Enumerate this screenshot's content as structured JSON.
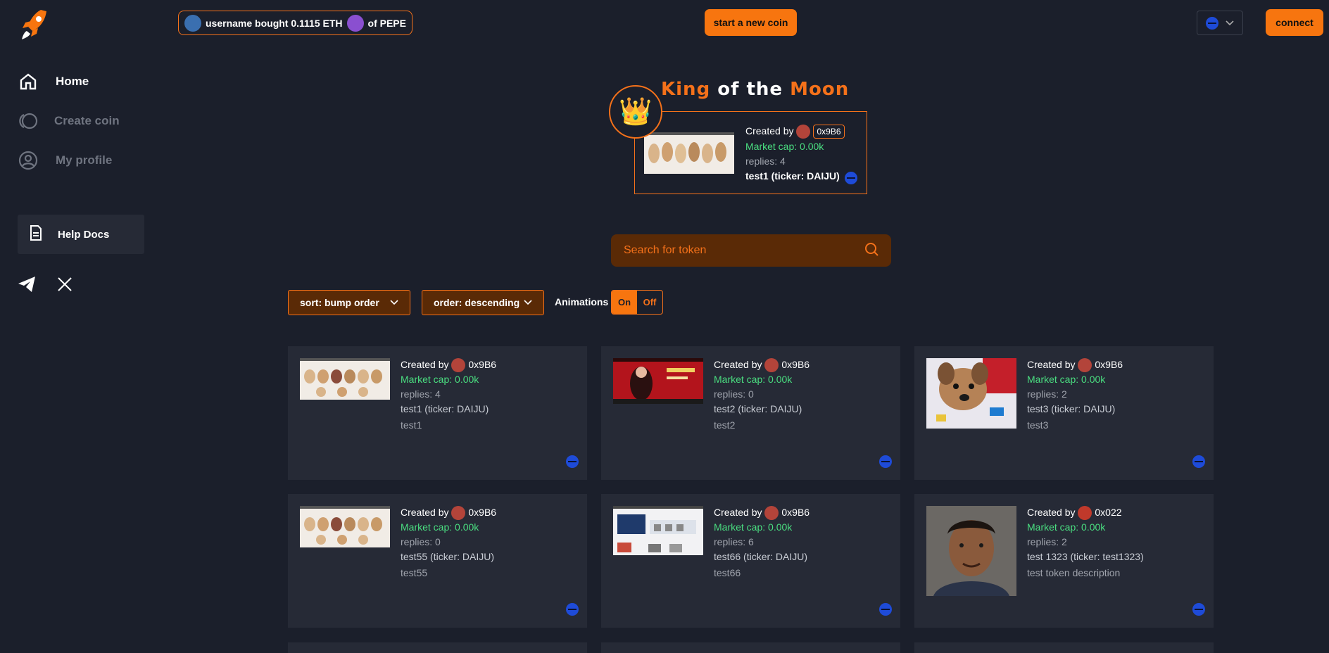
{
  "sidebar": {
    "items": [
      {
        "label": "Home",
        "icon": "home-icon"
      },
      {
        "label": "Create coin",
        "icon": "create-coin-icon"
      },
      {
        "label": "My profile",
        "icon": "profile-icon"
      }
    ],
    "help_docs": "Help Docs",
    "social": [
      "telegram-icon",
      "x-icon"
    ]
  },
  "topbar": {
    "ticker": {
      "user": "username bought 0.1115 ETH",
      "suffix": "of PEPE"
    },
    "start_coin": "start a new coin",
    "connect": "connect"
  },
  "king": {
    "title_1": "King",
    "title_2": "of the",
    "title_3": "Moon",
    "created_by": "Created by",
    "address": "0x9B6",
    "market_cap": "Market cap: 0.00k",
    "replies": "replies: 4",
    "name": "test1 (ticker: DAIJU)"
  },
  "search": {
    "placeholder": "Search for token"
  },
  "filters": {
    "sort": "sort: bump order",
    "order": "order: descending",
    "animations_label": "Animations",
    "on": "On",
    "off": "Off"
  },
  "colors": {
    "accent": "#f7750f",
    "market_cap": "#4ade80",
    "background": "#1b1f2b",
    "card": "#262a36"
  },
  "tokens": [
    {
      "created_by": "Created by",
      "address": "0x9B6",
      "market_cap": "Market cap: 0.00k",
      "replies": "replies: 4",
      "name": "test1 (ticker: DAIJU)",
      "desc": "test1",
      "image": "shells"
    },
    {
      "created_by": "Created by",
      "address": "0x9B6",
      "market_cap": "Market cap: 0.00k",
      "replies": "replies: 0",
      "name": "test2 (ticker: DAIJU)",
      "desc": "test2",
      "image": "red-banner"
    },
    {
      "created_by": "Created by",
      "address": "0x9B6",
      "market_cap": "Market cap: 0.00k",
      "replies": "replies: 2",
      "name": "test3 (ticker: DAIJU)",
      "desc": "test3",
      "image": "dog"
    },
    {
      "created_by": "Created by",
      "address": "0x9B6",
      "market_cap": "Market cap: 0.00k",
      "replies": "replies: 0",
      "name": "test55 (ticker: DAIJU)",
      "desc": "test55",
      "image": "shells"
    },
    {
      "created_by": "Created by",
      "address": "0x9B6",
      "market_cap": "Market cap: 0.00k",
      "replies": "replies: 6",
      "name": "test66 (ticker: DAIJU)",
      "desc": "test66",
      "image": "product"
    },
    {
      "created_by": "Created by",
      "address": "0x022",
      "market_cap": "Market cap: 0.00k",
      "replies": "replies: 2",
      "name": "test 1323 (ticker: test1323)",
      "desc": "test token description",
      "image": "portrait"
    }
  ]
}
